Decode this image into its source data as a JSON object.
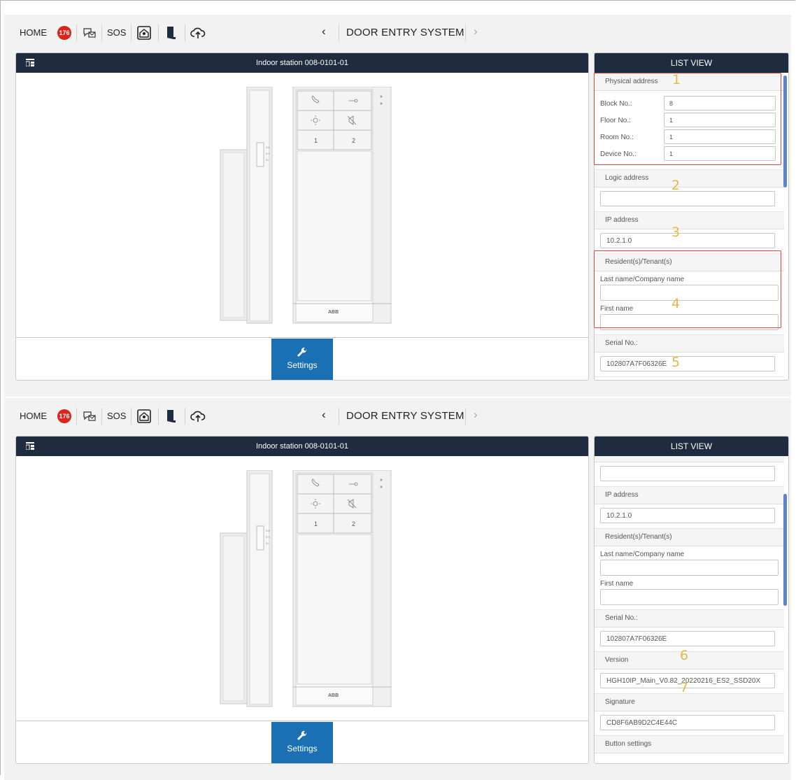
{
  "topbar": {
    "home_label": "HOME",
    "notification_count": "176",
    "sos_label": "SOS",
    "nav_title": "DOOR ENTRY SYSTEM",
    "prev_arrow": "‹",
    "next_arrow": "›"
  },
  "device": {
    "title": "Indoor station 008-0101-01",
    "brand": "ABB",
    "key_1": "1",
    "key_2": "2",
    "settings_label": "Settings"
  },
  "list_view": {
    "header": "LIST VIEW",
    "physical_address_label": "Physical address",
    "block_label": "Block No.:",
    "block_value": "8",
    "floor_label": "Floor No.:",
    "floor_value": "1",
    "room_label": "Room No.:",
    "room_value": "1",
    "device_label": "Device No.:",
    "device_value": "1",
    "logic_address_label": "Logic address",
    "logic_address_value": "",
    "ip_address_label": "IP address",
    "ip_address_value": "10.2.1.0",
    "residents_label": "Resident(s)/Tenant(s)",
    "last_name_label": "Last name/Company name",
    "first_name_label": "First name",
    "serial_label": "Serial No.:",
    "serial_value": "102807A7F06326E",
    "version_label": "Version",
    "version_value": "HGH10IP_Main_V0.82_20220216_ES2_SSD20X",
    "signature_label": "Signature",
    "signature_value": "CD8F6AB9D2C4E44C",
    "button_settings_label": "Button settings"
  },
  "annotations": {
    "n1": "1",
    "n2": "2",
    "n3": "3",
    "n4": "4",
    "n5": "5",
    "n6": "6",
    "n7": "7"
  },
  "colors": {
    "header_bg": "#1f2b3e",
    "settings_button": "#1b6fb3",
    "badge": "#d9251c",
    "highlight_box": "#e0443e",
    "annotation_number": "#e3b84a",
    "scrollbar": "#5b85c6"
  }
}
